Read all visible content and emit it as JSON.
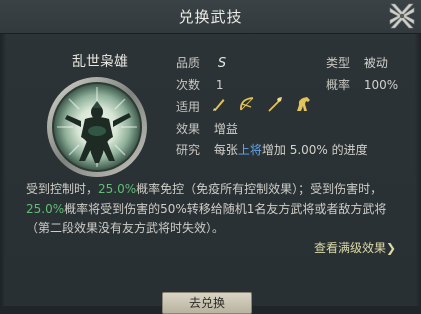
{
  "dialog": {
    "title": "兑换武技"
  },
  "skill": {
    "name": "乱世枭雄",
    "quality_label": "品质",
    "quality_value": "S",
    "type_label": "类型",
    "type_value": "被动",
    "count_label": "次数",
    "count_value": "1",
    "rate_label": "概率",
    "rate_value": "100%",
    "suit_label": "适用",
    "weapons": [
      "brush-icon",
      "bow-icon",
      "spear-icon",
      "horse-icon"
    ],
    "effect_label": "效果",
    "effect_value": "增益",
    "research_label": "研究",
    "research_prefix": "每张",
    "research_highlight": "上将",
    "research_suffix": "增加 5.00% 的进度"
  },
  "description": {
    "part1": "受到控制时，",
    "pct1": "25.0%",
    "part2": "概率免控（免疫所有控制效果）；受到伤害时，",
    "pct2": "25.0%",
    "part3": "概率将受到伤害的50%转移给随机1名友方武将或者敌方武将（第二段效果没有友方武将时失效）。"
  },
  "links": {
    "max_effect": "查看满级效果❯"
  },
  "buttons": {
    "bottom": "去兑换"
  },
  "colors": {
    "accent_green": "#5fbf72",
    "accent_blue": "#61a6ea",
    "weapon_icon": "#e2c25c"
  }
}
